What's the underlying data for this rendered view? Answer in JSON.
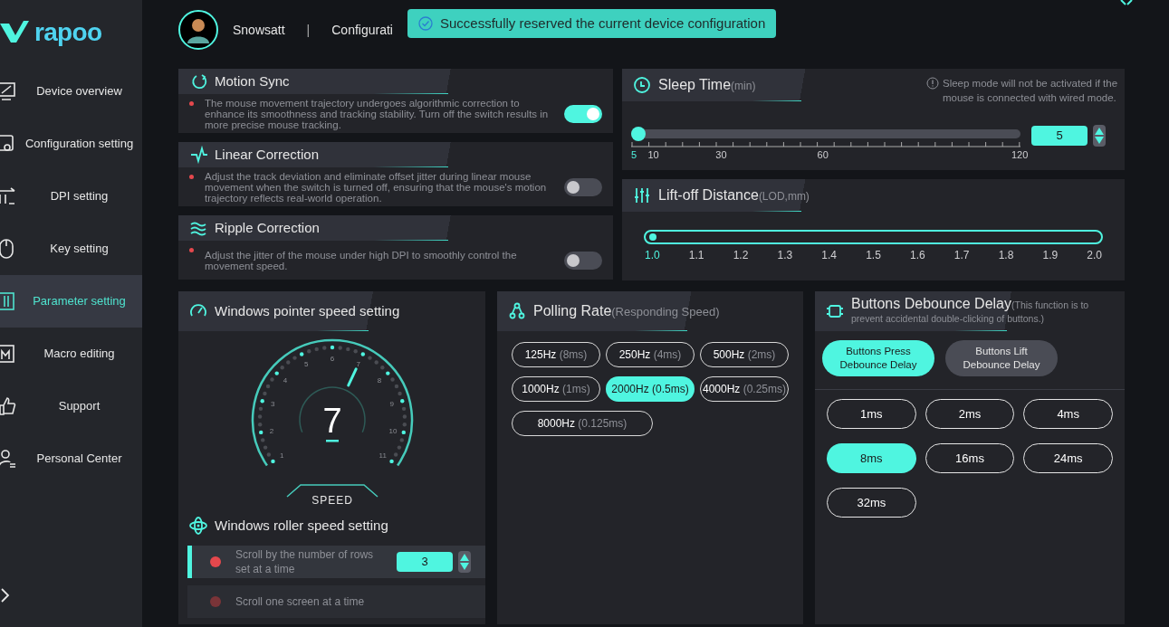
{
  "brand": {
    "logo_text": "rapoo"
  },
  "sidebar": {
    "items": [
      {
        "label": "Device overview",
        "selected": false
      },
      {
        "label": "Configuration setting",
        "selected": false
      },
      {
        "label": "DPI setting",
        "selected": false
      },
      {
        "label": "Key setting",
        "selected": false
      },
      {
        "label": "Parameter setting",
        "selected": true
      },
      {
        "label": "Macro editing",
        "selected": false
      },
      {
        "label": "Support",
        "selected": false
      },
      {
        "label": "Personal Center",
        "selected": false
      }
    ]
  },
  "header": {
    "user_name": "Snowsatt",
    "separator": "|",
    "configuration": "Configurati"
  },
  "toast": {
    "text": "Successfully reserved the current device configuration"
  },
  "switches": [
    {
      "title": "Motion Sync",
      "description": "The mouse movement trajectory undergoes algorithmic correction to enhance its smoothness and tracking stability. Turn off the switch results in more precise mouse tracking.",
      "on": true
    },
    {
      "title": "Linear Correction",
      "description": "Adjust the track deviation and eliminate offset jitter during linear mouse movement when the switch is turned off, ensuring that the mouse's motion trajectory reflects real-world operation.",
      "on": false
    },
    {
      "title": "Ripple Correction",
      "description": "Adjust the jitter of the mouse under high DPI to smoothly control the movement speed.",
      "on": false
    }
  ],
  "sleep_time": {
    "title": "Sleep Time",
    "unit": "(min)",
    "note": "Sleep mode will not be activated if the mouse is connected with wired mode.",
    "level": 0,
    "value": "5",
    "ticks": [
      "5",
      "10",
      "30",
      "60",
      "120"
    ]
  },
  "lift_off": {
    "title": "Lift-off Distance",
    "unit": "(LOD,mm)",
    "level": 0,
    "ticks": [
      {
        "label": "1.0",
        "selected": true
      },
      {
        "label": "1.1",
        "selected": false
      },
      {
        "label": "1.2",
        "selected": false
      },
      {
        "label": "1.3",
        "selected": false
      },
      {
        "label": "1.4",
        "selected": false
      },
      {
        "label": "1.5",
        "selected": false
      },
      {
        "label": "1.6",
        "selected": false
      },
      {
        "label": "1.7",
        "selected": false
      },
      {
        "label": "1.8",
        "selected": false
      },
      {
        "label": "1.9",
        "selected": false
      },
      {
        "label": "2.0",
        "selected": false
      }
    ]
  },
  "pointer_speed": {
    "title": "Windows pointer speed setting",
    "value": "7",
    "level": 0.6,
    "scale": [
      "1",
      "2",
      "3",
      "4",
      "5",
      "6",
      "7",
      "8",
      "9",
      "10",
      "11"
    ],
    "caption": "SPEED"
  },
  "roller_speed": {
    "title": "Windows roller speed setting",
    "options": [
      {
        "label": "Scroll by the number of rows set at a time",
        "selected": true,
        "value": "3"
      },
      {
        "label": "Scroll one screen at a time",
        "selected": false
      }
    ]
  },
  "polling_rate": {
    "title": "Polling Rate",
    "subtitle": "(Responding Speed)",
    "options": [
      {
        "rate": "125Hz",
        "interval": "(8ms)",
        "selected": false
      },
      {
        "rate": "250Hz",
        "interval": "(4ms)",
        "selected": false
      },
      {
        "rate": "500Hz",
        "interval": "(2ms)",
        "selected": false
      },
      {
        "rate": "1000Hz",
        "interval": "(1ms)",
        "selected": false
      },
      {
        "rate": "2000Hz",
        "interval": "(0.5ms)",
        "selected": true
      },
      {
        "rate": "4000Hz",
        "interval": "(0.25ms)",
        "selected": false
      },
      {
        "rate": "8000Hz",
        "interval": "(0.125ms)",
        "selected": false
      }
    ]
  },
  "debounce": {
    "title": "Buttons Debounce Delay",
    "subtitle": "(This function is to prevent accidental double-clicking of buttons.)",
    "modes": [
      {
        "label": "Buttons Press Debounce Delay",
        "selected": true
      },
      {
        "label": "Buttons Lift Debounce Delay",
        "selected": false
      }
    ],
    "options": [
      {
        "label": "1ms",
        "selected": false
      },
      {
        "label": "2ms",
        "selected": false
      },
      {
        "label": "4ms",
        "selected": false
      },
      {
        "label": "8ms",
        "selected": true
      },
      {
        "label": "16ms",
        "selected": false
      },
      {
        "label": "24ms",
        "selected": false
      },
      {
        "label": "32ms",
        "selected": false
      }
    ]
  }
}
